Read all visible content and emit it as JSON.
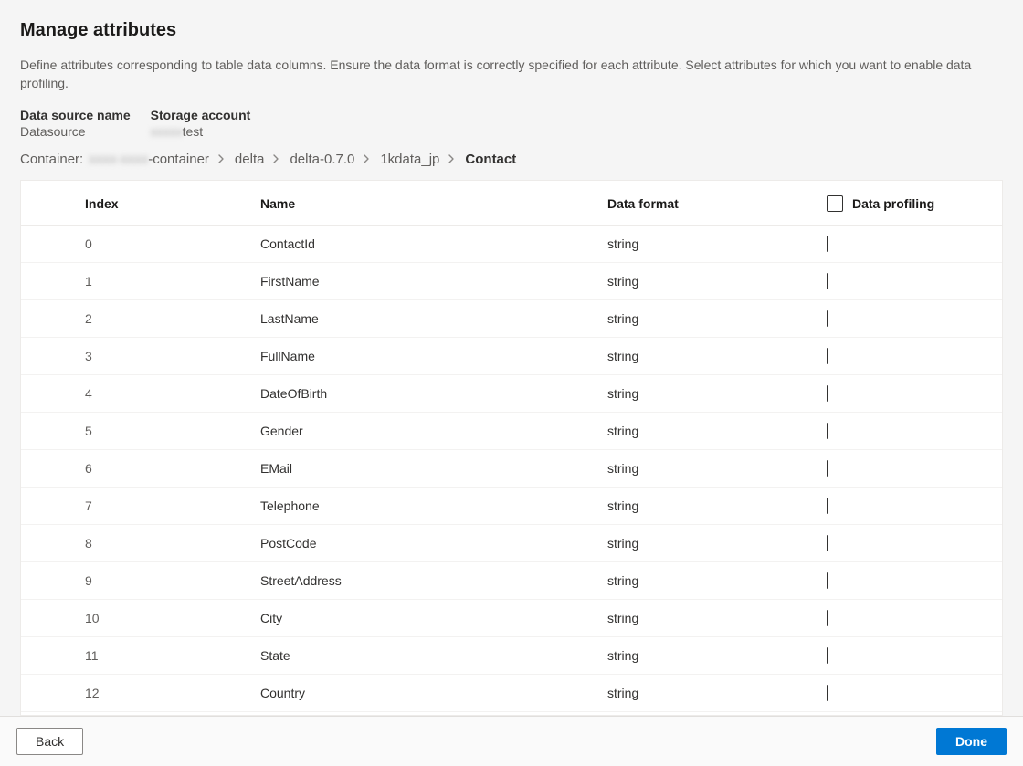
{
  "header": {
    "title": "Manage attributes",
    "description": "Define attributes corresponding to table data columns. Ensure the data format is correctly specified for each attribute. Select attributes for which you want to enable data profiling."
  },
  "meta": {
    "datasource_label": "Data source name",
    "datasource_value": "Datasource",
    "storage_label": "Storage account",
    "storage_value_prefix_blurred": "xxxxx",
    "storage_value_suffix": "test"
  },
  "breadcrumb": {
    "lead_label": "Container:",
    "container_prefix_blurred": "xxxx-xxxx",
    "container_suffix": "-container",
    "items": [
      {
        "label": "delta",
        "current": false
      },
      {
        "label": "delta-0.7.0",
        "current": false
      },
      {
        "label": "1kdata_jp",
        "current": false
      },
      {
        "label": "Contact",
        "current": true
      }
    ]
  },
  "table": {
    "headers": {
      "index": "Index",
      "name": "Name",
      "format": "Data format",
      "profiling": "Data profiling"
    },
    "rows": [
      {
        "index": "0",
        "name": "ContactId",
        "format": "string"
      },
      {
        "index": "1",
        "name": "FirstName",
        "format": "string"
      },
      {
        "index": "2",
        "name": "LastName",
        "format": "string"
      },
      {
        "index": "3",
        "name": "FullName",
        "format": "string"
      },
      {
        "index": "4",
        "name": "DateOfBirth",
        "format": "string"
      },
      {
        "index": "5",
        "name": "Gender",
        "format": "string"
      },
      {
        "index": "6",
        "name": "EMail",
        "format": "string"
      },
      {
        "index": "7",
        "name": "Telephone",
        "format": "string"
      },
      {
        "index": "8",
        "name": "PostCode",
        "format": "string"
      },
      {
        "index": "9",
        "name": "StreetAddress",
        "format": "string"
      },
      {
        "index": "10",
        "name": "City",
        "format": "string"
      },
      {
        "index": "11",
        "name": "State",
        "format": "string"
      },
      {
        "index": "12",
        "name": "Country",
        "format": "string"
      }
    ]
  },
  "footer": {
    "back": "Back",
    "done": "Done"
  }
}
